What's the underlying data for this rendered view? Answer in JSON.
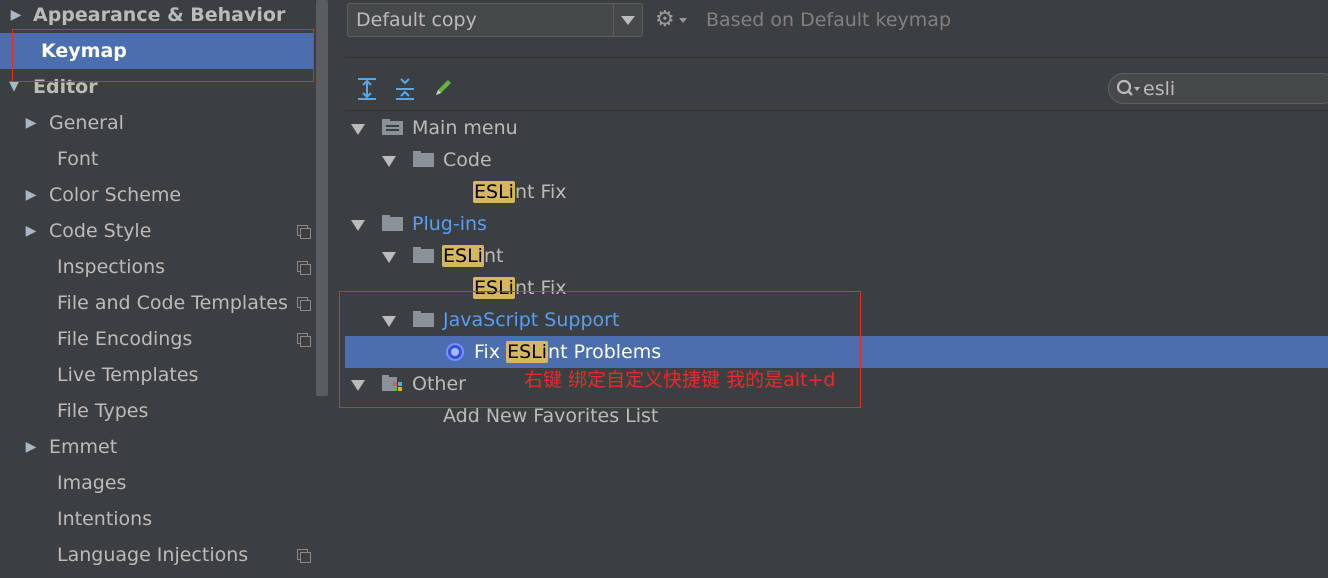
{
  "sidebar": {
    "items": [
      {
        "label": "Appearance & Behavior",
        "expandable": true,
        "bold": true
      },
      {
        "label": "Keymap",
        "bold": true,
        "selected": true
      },
      {
        "label": "Editor",
        "expandable": true,
        "expanded": true,
        "bold": true
      },
      {
        "label": "General",
        "expandable": true
      },
      {
        "label": "Font"
      },
      {
        "label": "Color Scheme",
        "expandable": true
      },
      {
        "label": "Code Style",
        "expandable": true,
        "copy_icon": true
      },
      {
        "label": "Inspections",
        "copy_icon": true
      },
      {
        "label": "File and Code Templates",
        "copy_icon": true
      },
      {
        "label": "File Encodings",
        "copy_icon": true
      },
      {
        "label": "Live Templates"
      },
      {
        "label": "File Types"
      },
      {
        "label": "Emmet",
        "expandable": true
      },
      {
        "label": "Images"
      },
      {
        "label": "Intentions"
      },
      {
        "label": "Language Injections",
        "copy_icon": true
      }
    ]
  },
  "keymap": {
    "selected": "Default copy",
    "based_on": "Based on Default keymap"
  },
  "icons": {
    "expand_all": "expand-all-icon",
    "collapse_all": "collapse-all-icon",
    "edit": "pencil-icon",
    "settings": "gear-icon",
    "search": "search-icon"
  },
  "search": {
    "value": "esli"
  },
  "tree": {
    "rows": [
      {
        "id": "main-menu",
        "label": "Main menu",
        "icon": "menu-folder"
      },
      {
        "id": "code",
        "label": "Code",
        "icon": "folder"
      },
      {
        "id": "eslint-fix-1",
        "highlight": "ESLi",
        "rest": "nt Fix"
      },
      {
        "id": "plug-ins",
        "label": "Plug-ins",
        "icon": "folder"
      },
      {
        "id": "eslint-group",
        "highlight": "ESLi",
        "rest": "nt",
        "icon": "folder"
      },
      {
        "id": "eslint-fix-2",
        "highlight": "ESLi",
        "rest": "nt Fix"
      },
      {
        "id": "js-support",
        "label": "JavaScript Support",
        "icon": "folder"
      },
      {
        "id": "fix-eslint-problems",
        "prefix": "Fix ",
        "highlight": "ESLi",
        "rest": "nt Problems",
        "icon": "action"
      },
      {
        "id": "other",
        "label": "Other",
        "icon": "other-folder"
      },
      {
        "id": "add-favorites",
        "label": "Add New Favorites List"
      }
    ]
  },
  "annotation": {
    "text": "右键 绑定自定义快捷键   我的是alt+d"
  },
  "colors": {
    "background": "#3c3f41",
    "selection": "#4b6eaf",
    "match_highlight": "#d6b65e",
    "plugin_blue": "#589df6",
    "annotation_red": "#e22b2b"
  }
}
